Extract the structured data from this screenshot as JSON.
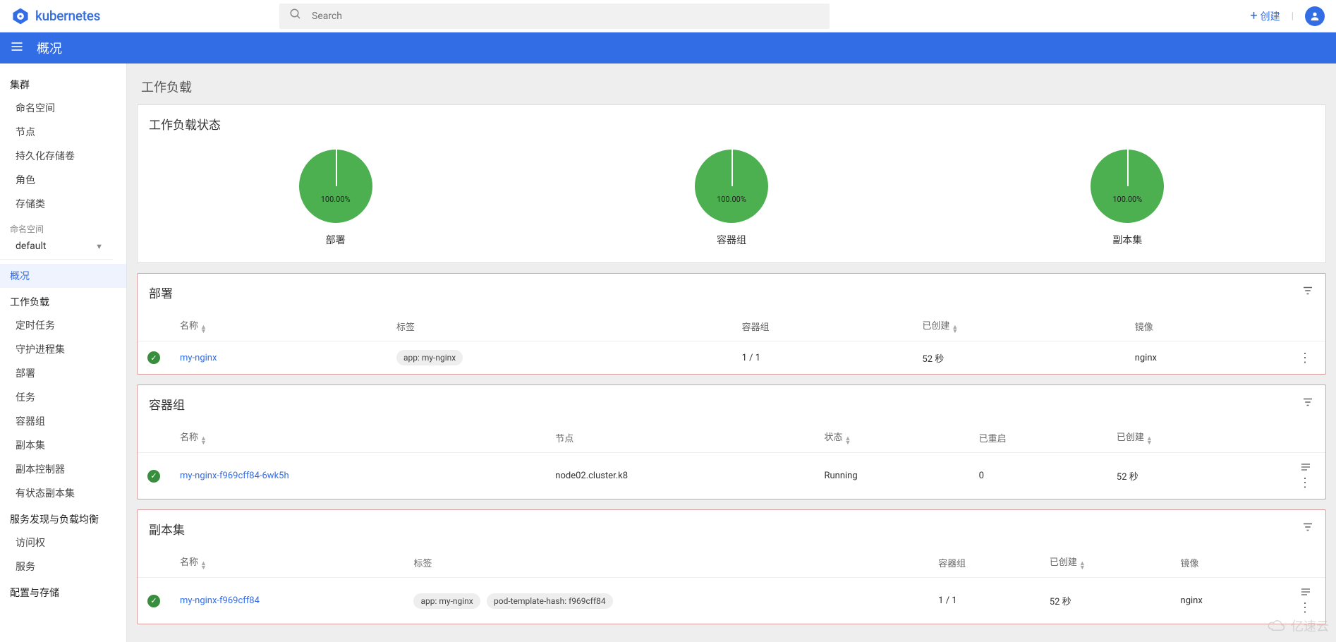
{
  "header": {
    "app_name": "kubernetes",
    "search_placeholder": "Search",
    "create_label": "创建"
  },
  "bluebar": {
    "title": "概况"
  },
  "sidebar": {
    "cluster_title": "集群",
    "cluster_items": [
      "命名空间",
      "节点",
      "持久化存储卷",
      "角色",
      "存储类"
    ],
    "namespace_label": "命名空间",
    "namespace_selected": "default",
    "overview": "概况",
    "workloads_title": "工作负载",
    "workloads_items": [
      "定时任务",
      "守护进程集",
      "部署",
      "任务",
      "容器组",
      "副本集",
      "副本控制器",
      "有状态副本集"
    ],
    "discovery_title": "服务发现与负载均衡",
    "discovery_items": [
      "访问权",
      "服务"
    ],
    "config_title": "配置与存储"
  },
  "main": {
    "workload_title": "工作负载",
    "status_card_title": "工作负载状态",
    "chart_data": [
      {
        "type": "pie",
        "series": [
          {
            "name": "部署",
            "value": 100.0
          }
        ],
        "label": "100.00%",
        "caption": "部署"
      },
      {
        "type": "pie",
        "series": [
          {
            "name": "容器组",
            "value": 100.0
          }
        ],
        "label": "100.00%",
        "caption": "容器组"
      },
      {
        "type": "pie",
        "series": [
          {
            "name": "副本集",
            "value": 100.0
          }
        ],
        "label": "100.00%",
        "caption": "副本集"
      }
    ],
    "deployments": {
      "title": "部署",
      "columns": {
        "name": "名称",
        "labels": "标签",
        "pods": "容器组",
        "created": "已创建",
        "images": "镜像"
      },
      "rows": [
        {
          "name": "my-nginx",
          "labels": [
            "app: my-nginx"
          ],
          "pods": "1 / 1",
          "created": "52 秒",
          "images": "nginx"
        }
      ]
    },
    "pods": {
      "title": "容器组",
      "columns": {
        "name": "名称",
        "node": "节点",
        "status": "状态",
        "restarts": "已重启",
        "created": "已创建"
      },
      "rows": [
        {
          "name": "my-nginx-f969cff84-6wk5h",
          "node": "node02.cluster.k8",
          "status": "Running",
          "restarts": "0",
          "created": "52 秒"
        }
      ]
    },
    "replicasets": {
      "title": "副本集",
      "columns": {
        "name": "名称",
        "labels": "标签",
        "pods": "容器组",
        "created": "已创建",
        "images": "镜像"
      },
      "rows": [
        {
          "name": "my-nginx-f969cff84",
          "labels": [
            "app: my-nginx",
            "pod-template-hash: f969cff84"
          ],
          "pods": "1 / 1",
          "created": "52 秒",
          "images": "nginx"
        }
      ]
    }
  },
  "watermark": "亿速云"
}
